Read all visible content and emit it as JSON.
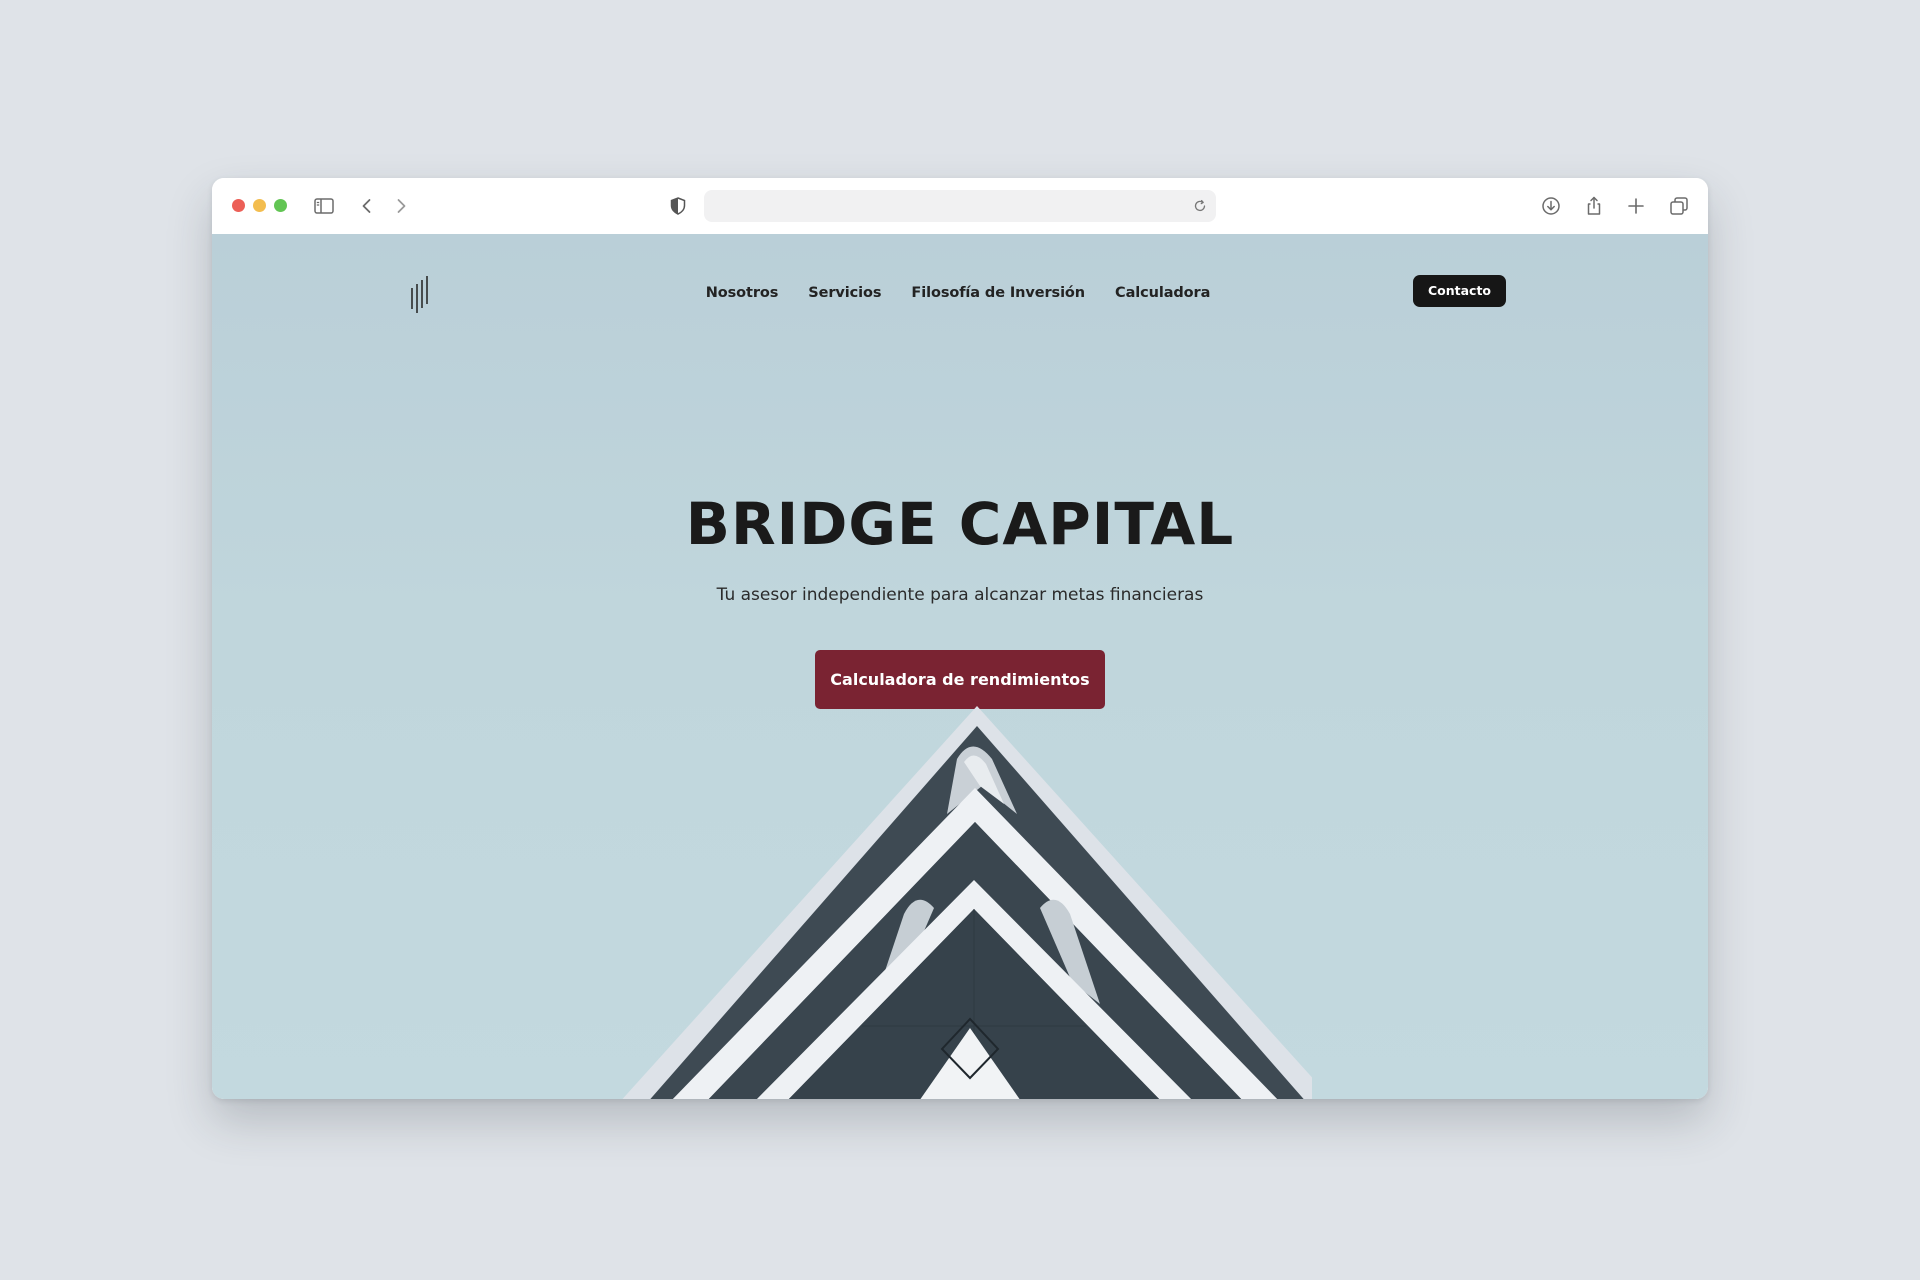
{
  "browser": {
    "traffic_lights": {
      "close": "#ec5f57",
      "minimize": "#f3bd4f",
      "maximize": "#62c554"
    },
    "address_bar": {
      "value": "",
      "placeholder": ""
    },
    "icons": {
      "sidebar": "sidebar-icon",
      "back": "chevron-left-icon",
      "forward": "chevron-right-icon",
      "privacy": "shield-icon",
      "reload": "reload-icon",
      "download": "download-icon",
      "share": "share-icon",
      "new_tab": "plus-icon",
      "tabs": "tabs-overview-icon"
    }
  },
  "site": {
    "logo_icon": "bridge-capital-logo",
    "nav": {
      "items": [
        {
          "label": "Nosotros"
        },
        {
          "label": "Servicios"
        },
        {
          "label": "Filosofía de Inversión"
        },
        {
          "label": "Calculadora"
        }
      ],
      "contact_label": "Contacto"
    },
    "hero": {
      "title": "BRIDGE CAPITAL",
      "subtitle": "Tu asesor independiente para alcanzar metas financieras",
      "cta_label": "Calculadora de rendimientos"
    },
    "colors": {
      "sky": "#bfd4db",
      "cta": "#7a2332",
      "contact": "#161616",
      "text": "#1a1a1a"
    }
  }
}
